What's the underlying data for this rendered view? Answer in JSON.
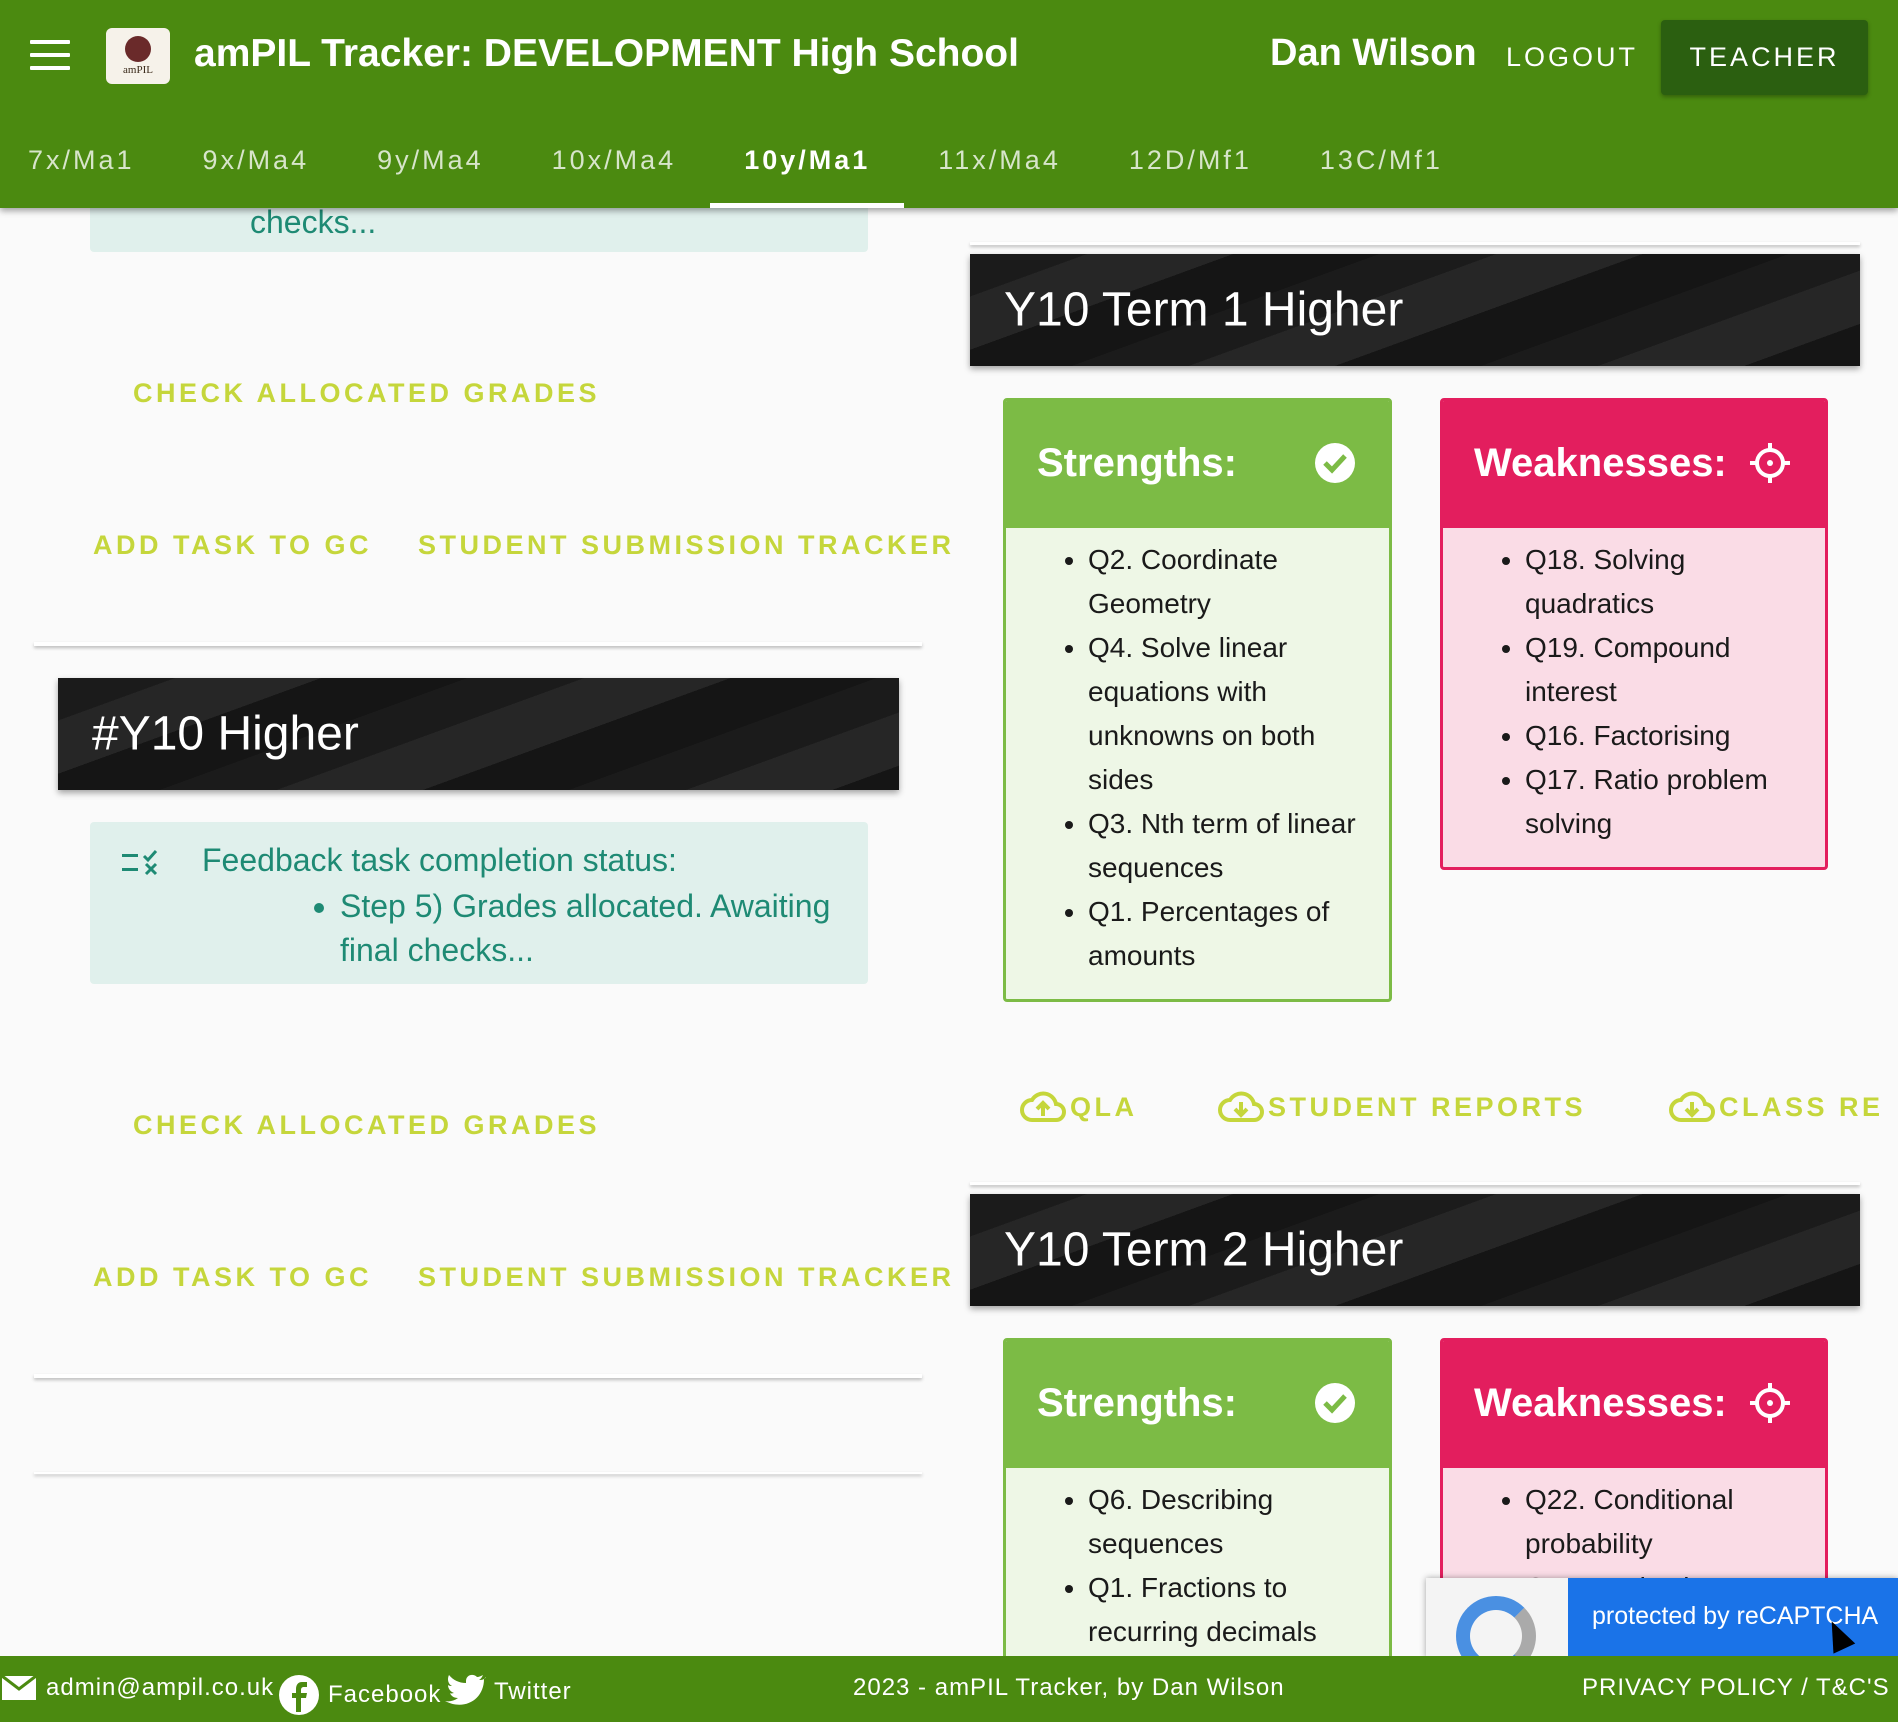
{
  "header": {
    "app_title": "amPIL Tracker: DEVELOPMENT High School",
    "logo_text": "amPIL",
    "user_name": "Dan Wilson",
    "logout_label": "LOGOUT",
    "role_label": "TEACHER"
  },
  "tabs": [
    {
      "label": "7x/Ma1"
    },
    {
      "label": "9x/Ma4"
    },
    {
      "label": "9y/Ma4"
    },
    {
      "label": "10x/Ma4"
    },
    {
      "label": "10y/Ma1",
      "active": true
    },
    {
      "label": "11x/Ma4"
    },
    {
      "label": "12D/Mf1"
    },
    {
      "label": "13C/Mf1"
    }
  ],
  "left_column": {
    "top_partial_text": "checks...",
    "block1": {
      "check_grades_label": "CHECK ALLOCATED GRADES",
      "add_task_label": "ADD TASK TO GC",
      "tracker_label": "STUDENT SUBMISSION TRACKER"
    },
    "group_card": {
      "title": "#Y10 Higher",
      "status_heading": "Feedback task completion status:",
      "status_item": "Step 5) Grades allocated. Awaiting final checks...",
      "check_grades_label": "CHECK ALLOCATED GRADES",
      "add_task_label": "ADD TASK TO GC",
      "tracker_label": "STUDENT SUBMISSION TRACKER"
    }
  },
  "right_column": {
    "assessments": [
      {
        "title": "Y10 Term 1 Higher",
        "strengths_title": "Strengths:",
        "weaknesses_title": "Weaknesses:",
        "strengths": [
          "Q2. Coordinate Geometry",
          "Q4. Solve linear equations with unknowns on both sides",
          "Q3. Nth term of linear sequences",
          "Q1. Percentages of amounts"
        ],
        "weaknesses": [
          "Q18. Solving quadratics",
          "Q19. Compound interest",
          "Q16. Factorising",
          "Q17. Ratio problem solving"
        ],
        "downloads": {
          "qla": "QLA",
          "student_reports": "STUDENT REPORTS",
          "class_reports": "CLASS RE"
        }
      },
      {
        "title": "Y10 Term 2 Higher",
        "strengths_title": "Strengths:",
        "weaknesses_title": "Weaknesses:",
        "strengths": [
          "Q6. Describing sequences",
          "Q1. Fractions to recurring decimals"
        ],
        "weaknesses": [
          "Q22. Conditional probability",
          "Q11. Angles in"
        ]
      }
    ]
  },
  "recaptcha": {
    "text": "protected by reCAPTCHA"
  },
  "footer": {
    "email": "admin@ampil.co.uk",
    "facebook": "Facebook",
    "twitter": "Twitter",
    "copyright": "2023 - amPIL Tracker, by Dan Wilson",
    "policy": "PRIVACY POLICY / T&C'S"
  },
  "colors": {
    "header_green": "#4b8a10",
    "teacher_button": "#2b5f10",
    "action_text": "#c5d63b",
    "status_teal": "#1e8a74",
    "strength_green": "#7cbb45",
    "weakness_pink": "#e31e5e"
  }
}
